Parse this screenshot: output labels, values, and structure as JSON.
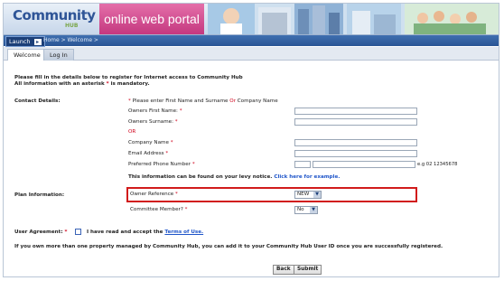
{
  "header": {
    "logo_main": "Community",
    "logo_sub": "HUB",
    "portal_title": "online web portal"
  },
  "nav": {
    "launch_label": "Launch",
    "breadcrumb": "Home > Welcome >"
  },
  "tabs": [
    {
      "label": "Welcome"
    },
    {
      "label": "Log In"
    }
  ],
  "intro": {
    "line1": "Please fill in the details below to register for Internet access to Community Hub",
    "line2_prefix": "All information with an asterisk",
    "line2_star": "*",
    "line2_suffix": "is mandatory."
  },
  "contact": {
    "section_label": "Contact Details:",
    "hint_star": "*",
    "hint_text": "Please enter First Name and Surname",
    "hint_or": "Or",
    "hint_tail": "Company Name",
    "owner_first_label": "Owners First Name:",
    "owner_surname_label": "Owners Surname:",
    "or_label": "OR",
    "company_label": "Company Name",
    "email_label": "Email Address",
    "phone_label": "Preferred Phone Number",
    "phone_hint": "e.g 02 12345678",
    "star": "*",
    "levy_text": "This information can be found on your levy notice.",
    "levy_link": "Click here for example."
  },
  "plan": {
    "section_label": "Plan Information:",
    "owner_ref_label": "Owner Reference",
    "owner_ref_value": "NEW",
    "committee_label": "Committee Member?",
    "committee_value": "No",
    "star": "*"
  },
  "agreement": {
    "label": "User Agreement:",
    "star": "*",
    "text": "I have read and accept the",
    "link": "Terms of Use."
  },
  "footer_note": "If you own more than one property managed by Community Hub, you can add it to your Community Hub User ID once you are successfully registered.",
  "buttons": {
    "back": "Back",
    "submit": "Submit"
  },
  "colors": {
    "portal_pink": "#c4387f",
    "nav_blue": "#2a5594",
    "highlight_red": "#d11b1b",
    "asterisk_red": "#d0021b",
    "link_blue": "#1f55c9"
  }
}
